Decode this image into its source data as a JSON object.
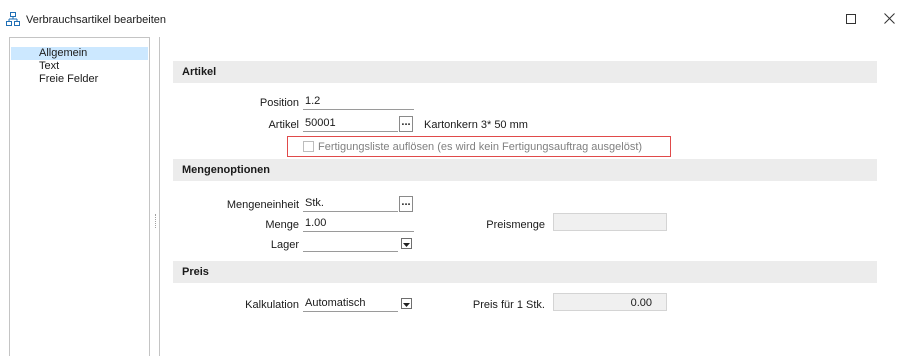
{
  "window": {
    "title": "Verbrauchsartikel bearbeiten",
    "icons": {
      "app": "org-chart-icon",
      "maximize": "maximize-icon",
      "close": "close-icon"
    }
  },
  "sidebar": {
    "items": [
      {
        "label": "Allgemein",
        "selected": true
      },
      {
        "label": "Text",
        "selected": false
      },
      {
        "label": "Freie Felder",
        "selected": false
      }
    ]
  },
  "sections": {
    "artikel": {
      "header": "Artikel",
      "position_label": "Position",
      "position_value": "1.2",
      "artikel_label": "Artikel",
      "artikel_value": "50001",
      "artikel_button": "...",
      "artikel_description": "Kartonkern 3* 50 mm",
      "checkbox_label": "Fertigungsliste auflösen (es wird kein Fertigungsauftrag ausgelöst)",
      "checkbox_checked": false
    },
    "mengenoptionen": {
      "header": "Mengenoptionen",
      "mengeneinheit_label": "Mengeneinheit",
      "mengeneinheit_value": "Stk.",
      "mengeneinheit_button": "...",
      "menge_label": "Menge",
      "menge_value": "1.00",
      "preismenge_label": "Preismenge",
      "preismenge_value": "",
      "lager_label": "Lager",
      "lager_value": ""
    },
    "preis": {
      "header": "Preis",
      "kalkulation_label": "Kalkulation",
      "kalkulation_value": "Automatisch",
      "preis_label": "Preis für 1 Stk.",
      "preis_value": "0.00"
    }
  },
  "colors": {
    "sidebar_selected": "#cce8ff",
    "section_header_bg": "#ececec",
    "highlight_border": "#e04a4a",
    "readonly_bg": "#f0f0f0"
  }
}
